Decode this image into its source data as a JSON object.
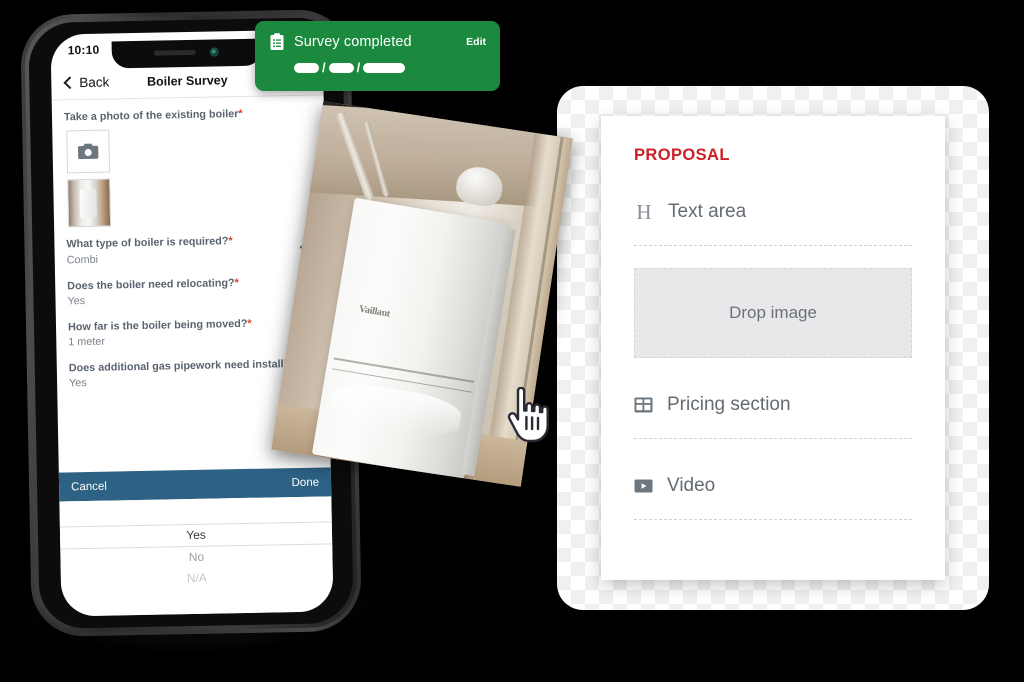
{
  "phone": {
    "status_time": "10:10",
    "nav": {
      "back_label": "Back",
      "title": "Boiler Survey"
    },
    "questions": [
      {
        "label": "Take a photo of the existing boiler",
        "required": "*",
        "answer": "",
        "has_chevron": false
      },
      {
        "label": "What type of boiler is required?",
        "required": "*",
        "answer": "Combi",
        "has_chevron": true
      },
      {
        "label": "Does the boiler need relocating?",
        "required": "*",
        "answer": "Yes",
        "has_chevron": true
      },
      {
        "label": "How far is the boiler being moved?",
        "required": "*",
        "answer": "1 meter",
        "has_chevron": false
      },
      {
        "label": "Does additional gas pipework need installing?",
        "required": "*",
        "answer": "Yes",
        "has_chevron": false
      }
    ],
    "picker": {
      "cancel_label": "Cancel",
      "done_label": "Done",
      "options": [
        "Yes",
        "No",
        "N/A"
      ],
      "selected": "Yes"
    }
  },
  "toast": {
    "title": "Survey completed",
    "edit_label": "Edit",
    "date_redacted": "██/██/████",
    "separator": "/",
    "background_color": "#1b8a3e"
  },
  "proposal": {
    "title": "PROPOSAL",
    "title_color": "#cc2027",
    "items": [
      {
        "icon": "heading-icon",
        "label": "Text area"
      },
      {
        "icon": "image-drop-icon",
        "label": "Drop image"
      },
      {
        "icon": "table-icon",
        "label": "Pricing section"
      },
      {
        "icon": "video-icon",
        "label": "Video"
      }
    ],
    "drop_label": "Drop image"
  },
  "photo": {
    "brand_text": "Vaillant",
    "alt": "Wall mounted combi boiler inside cupboard"
  },
  "colors": {
    "toolbar_blue": "#2d6285",
    "chevron_blue": "#2e5f83",
    "required_red": "#e23b2e",
    "label_gray": "#5a6470",
    "answer_gray": "#7b828c"
  }
}
